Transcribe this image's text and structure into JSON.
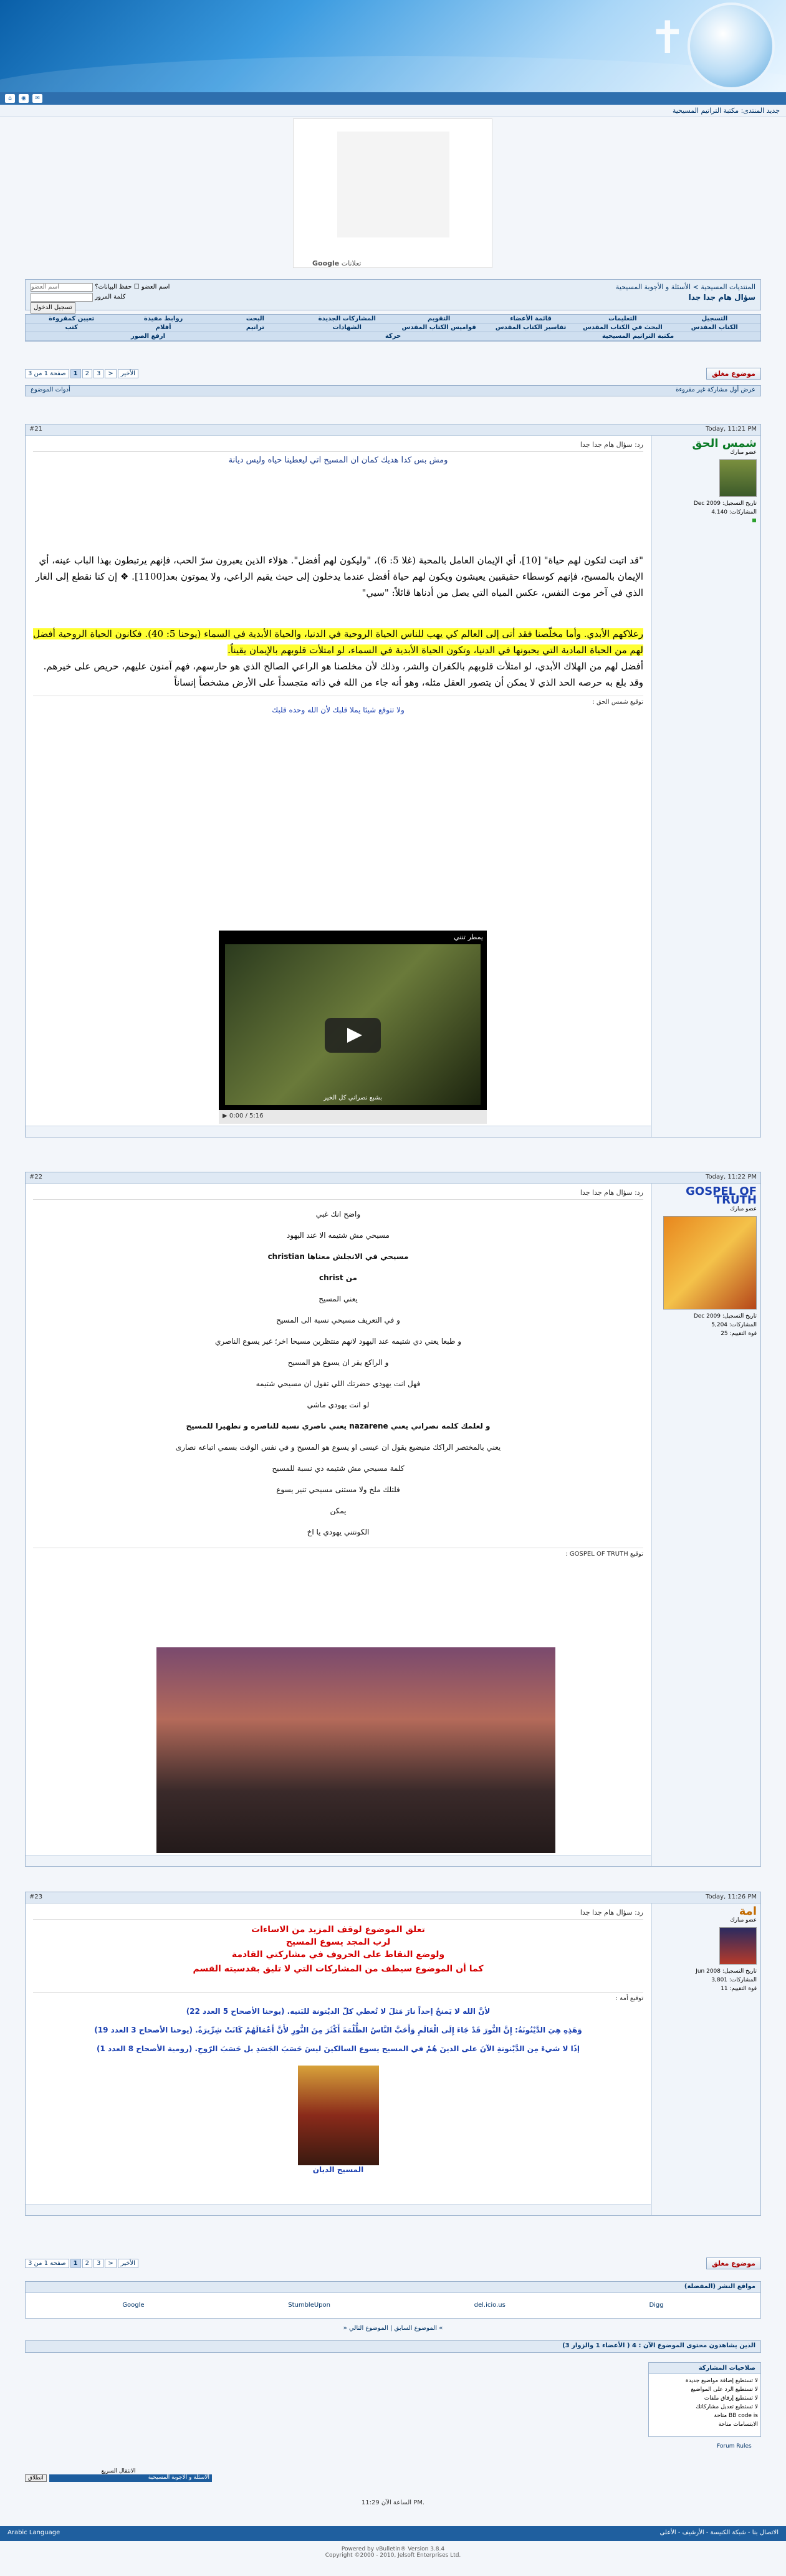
{
  "header": {
    "new_topic_label": "جديد المنتدى: مكتبة التراتيم المسيحية"
  },
  "ad": {
    "google_label": "Google",
    "google_suffix": "تعلانات",
    "ad_text": "إعلانات"
  },
  "breadcrumb": {
    "parts": "المنتديات المسيحية > الأسئلة و الأجوبة المسيحية",
    "title": "سؤال هام جدا جدا"
  },
  "login": {
    "user_label": "اسم العضو",
    "user_placeholder": "اسم العضو",
    "remember": "حفظ البيانات؟",
    "pass_label": "كلمة المرور",
    "login_button": "تسجيل الدخول"
  },
  "menu": {
    "row1": [
      "التسجيل",
      "التعليمات",
      "قائمة الأعضاء",
      "التقويم",
      "المشاركات الجديدة",
      "البحث",
      "روابط مفيدة",
      "تعيين كمقروءة"
    ],
    "row2": [
      "الكتاب المقدس",
      "البحث في الكتاب المقدس",
      "تفاسير الكتاب المقدس",
      "قواميس الكتاب المقدس",
      "الشهادات",
      "ترانيم",
      "أفلام",
      "كتب"
    ],
    "row3": [
      "مكتبة التراتيم المسيحية",
      "حركة",
      "ارفع الصور"
    ]
  },
  "pager": {
    "label": "صفحة 1 من 3",
    "pages": [
      "1",
      "2",
      "3",
      ">",
      "الأخير"
    ],
    "reply_label": "موضوع مغلق"
  },
  "tools": {
    "left": "أدوات الموضوع",
    "right": "عرض أول مشاركة غير مقروءة"
  },
  "posts": [
    {
      "number": "#21",
      "date": "Today, 11:21 PM",
      "title": "رد: سؤال هام جدا جدا",
      "username": "شمس الحق",
      "rank": "عضو مبارك",
      "join_label": "تاريخ التسجيل: Dec 2009",
      "posts_label": "المشاركات: 4,140",
      "heading": "ومش بس كدا هديك كمان ان المسيح اتي ليعطينا حياه وليس ديانة",
      "para1": "\"قد اتيت لتكون لهم حياة\" [10]، أي الإيمان العامل بالمحبة (غلا 5: 6)، \"وليكون لهم أفضل\". هؤلاء الذين يعبرون سرّ الحب، فإنهم يرتبطون بهذا الباب عينه، أي الإيمان بالمسيح، فإنهم كوسطاء حقيقيين يعيشون ويكون لهم حياة أفضل عندما يدخلون إلى حيث يقيم الراعي، ولا يموتون بعد[1100]. ❖ إن كنا نقطع إلى الغار الذي في آخر موت النفس، عكس المياه التي يصل من أدناها قائلاً: \"سيي\"",
      "para2": "رعلاكهم الأبدي. وأما مخلّصنا فقد أتى إلى العالم كي يهب للناس الحياة الروحية في الدنيا، والحياة الأبدية في السماء (يوحنا 5: 40). فكانون الحياة الروحية أفضل لهم من الحياة المادية التي يحبونها في الدنيا، وتكون الحياة الأبدية في السماء، لو امتلأت قلوبهم بالإيمان يقيناً.",
      "para3": "أفضل لهم من الهلاك الأبدي، لو امتلأت قلوبهم بالكفران والشر، وذلك لأن مخلصنا هو الراعي الصالح الذي هو حارسهم، فهم آمنون عليهم، حريص على خيرهم. وقد بلغ به حرصه الحد الذي لا يمكن أن يتصور العقل مثله، وهو أنه جاء من الله في ذاته متجسداً على الأرض مشخصاً إنساناً",
      "signature_label": "توقيع شمس الحق :",
      "signature_text": "ولا تتوقع شيئا يملا قلبك لأن الله وحده قلبك",
      "video_title": "يمطر تنني",
      "video_caption": "بشبع نصراني كل الخير",
      "video_time": "0:00 / 5:16"
    },
    {
      "number": "#22",
      "date": "Today, 11:22 PM",
      "title": "رد: سؤال هام جدا جدا",
      "username": "GOSPEL OF TRUTH",
      "rank": "عضو مبارك",
      "join_label": "تاريخ التسجيل: Dec 2009",
      "posts_label": "المشاركات: 5,204",
      "rep_label": "قوة التقييم: 25",
      "lines": [
        "واضح انك غبي",
        "مسيحي مش شتيمه الا عند اليهود",
        "مسيحي في الانجلش معناها christian",
        "من christ",
        "يعني المسيح",
        "و في التعريف مسيحي نسبة الى المسيح",
        "و طبعا يعني دي شتيمه عند اليهود لانهم منتظرين مسيحا اخر؛ غير يسوع الناصري",
        "و الراكع يقر ان يسوع هو المسيح",
        "فهل انت يهودي حضرتك اللي تقول ان مسيحي شتيمه",
        "لو انت يهودي ماشي",
        "و لعلمك كلمه نصراني يعني nazarene يعني ناصري نسبة للناصره و تطهيرا للمسيح",
        "يعني بالمختصر الراكك منيضيع يقول ان عيسى او يسوع هو المسيح و في نفس الوقت بسمي اتباعه نصارى",
        "كلمة مسيحي مش شتيمه دي نسبة للمسيح",
        "فلتلك ملخ ولا مستنى مسيحي تنير يسوع",
        "يمكن",
        "الكونتني يهودي يا اخ"
      ],
      "signature_label": "توقيع GOSPEL OF TRUTH :"
    },
    {
      "number": "#23",
      "date": "Today, 11:26 PM",
      "title": "رد: سؤال هام جدا جدا",
      "username": "امة",
      "rank": "عضو مبارك",
      "join_label": "تاريخ التسجيل: Jun 2008",
      "posts_label": "المشاركات: 3,801",
      "rep_label": "قوة التقييم: 11",
      "msg1": "تعلق الموضوع لوقف المزيد من الاساءات",
      "msg2": "لرب المجد يسوع المسيح",
      "msg3": "ولوضع النقاط على الحروف في مشاركتي القادمة",
      "msg4": "كما أن الموضوع سيطف من المشاركات التي لا تليق بقدسيته القسم",
      "signature_label": "توقيع أمة :",
      "verse1": "لأنَّ الله لا يَمنحُ إحداً نارَ مَثلَ لا تُعطي كلّ الديْتونة للبَنيه. (يوحنا الأصحاح 5 العدد 22)",
      "verse2": "وَهَذِهِ هِيَ الدَّيْنُونَةُ: إِنَّ النُّورَ قَدْ جَاءَ إِلَى الْعَالَمِ وَأَحَبَّ النَّاسُ الظُّلْمَةَ أَكْثَرَ مِنَ النُّورِ لأَنَّ أَعْمَالَهُمْ كَانَتْ شِرِّيرَةً. (يوحنا الأصحاح 3 العدد 19)",
      "verse3": "إذًا لا شيءَ مِن الدَّيْنونةِ الآنَ على الذينَ هُمْ في المسيح يسوع السالكينَ ليسَ حَسَبَ الجَسَدِ بل حَسَبَ الرّوحِ. (رومية الأصحاح 8 العدد 1)",
      "icon_caption": "المسيح الديان"
    }
  ],
  "bookmarks": {
    "label": "مواقع النشر (المفضلة)",
    "items": [
      "Google",
      "StumbleUpon",
      "del.icio.us",
      "Digg"
    ]
  },
  "thread_nav": "» الموضوع السابق | الموضوع التالي «",
  "viewers": "الذين يشاهدون محتوى الموضوع الآن : 4 ( الأعضاء 1 والزوار 3)",
  "permissions": {
    "title": "صلاحيات المشاركة",
    "items": [
      "لا تستطيع إضافة مواضيع جديدة",
      "لا تستطيع الرد على المواضيع",
      "لا تستطيع إرفاق ملفات",
      "لا تستطيع تعديل مشاركاتك"
    ],
    "codes": [
      "BB code is متاحة",
      "الابتسامات متاحة",
      "كود [IMG] متاحة",
      "كود HTML معطلة"
    ],
    "rules_link": "Forum Rules"
  },
  "jump": {
    "label": "الانتقال السريع",
    "selected": "الأسئلة و الأجوبة المسيحية",
    "go": "انطلاق"
  },
  "time_note": "الساعة الآن 11:29 PM.",
  "bottom": {
    "links": "الاتصال بنا - شبكة الكنيسة - الأرشيف - الأعلى",
    "language": "Arabic Language",
    "copyright": "Powered by vBulletin® Version 3.8.4\nCopyright ©2000 - 2010, Jelsoft Enterprises Ltd."
  }
}
